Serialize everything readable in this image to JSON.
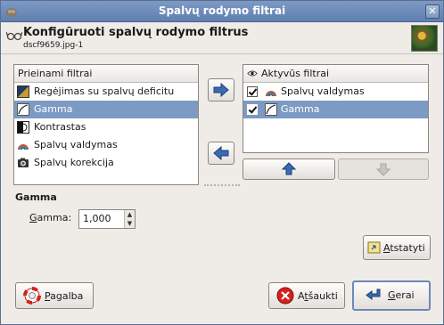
{
  "window": {
    "title": "Spalvų rodymo filtrai",
    "close_glyph": "✕"
  },
  "header": {
    "title": "Konfigūruoti spalvų rodymo filtrus",
    "subtitle": "dscf9659.jpg-1",
    "icon": "glasses-icon",
    "thumbnail": "image-thumbnail"
  },
  "available": {
    "header": "Prieinami filtrai",
    "items": [
      {
        "label": "Regėjimas su spalvų deficitu",
        "icon": "color-deficient-icon",
        "selected": false
      },
      {
        "label": "Gamma",
        "icon": "gamma-icon",
        "selected": true
      },
      {
        "label": "Kontrastas",
        "icon": "contrast-icon",
        "selected": false
      },
      {
        "label": "Spalvų valdymas",
        "icon": "color-management-icon",
        "selected": false
      },
      {
        "label": "Spalvų korekcija",
        "icon": "color-correction-icon",
        "selected": false
      }
    ]
  },
  "active": {
    "header": "Aktyvūs filtrai",
    "header_icon": "eye-icon",
    "items": [
      {
        "label": "Spalvų valdymas",
        "icon": "color-management-icon",
        "checked": true,
        "selected": false
      },
      {
        "label": "Gamma",
        "icon": "gamma-icon",
        "checked": true,
        "selected": true
      }
    ]
  },
  "controls": {
    "add_glyph": "➡",
    "remove_glyph": "⬅",
    "up_glyph": "⬆",
    "down_glyph": "⬇"
  },
  "settings": {
    "section_title": "Gamma",
    "gamma_label_mnemonic": "G",
    "gamma_label_rest": "amma:",
    "gamma_value": "1,000",
    "spin_up": "▲",
    "spin_down": "▼"
  },
  "buttons": {
    "reset_mnemonic": "A",
    "reset_rest": "tstatyti",
    "help_mnemonic": "P",
    "help_rest": "agalba",
    "cancel_prefix": "A",
    "cancel_mnemonic": "t",
    "cancel_rest": "šaukti",
    "ok_mnemonic": "G",
    "ok_rest": "erai"
  },
  "colors": {
    "selection": "#7d9ac4",
    "arrow_blue": "#3a6ab0",
    "cancel_red": "#d42020"
  }
}
